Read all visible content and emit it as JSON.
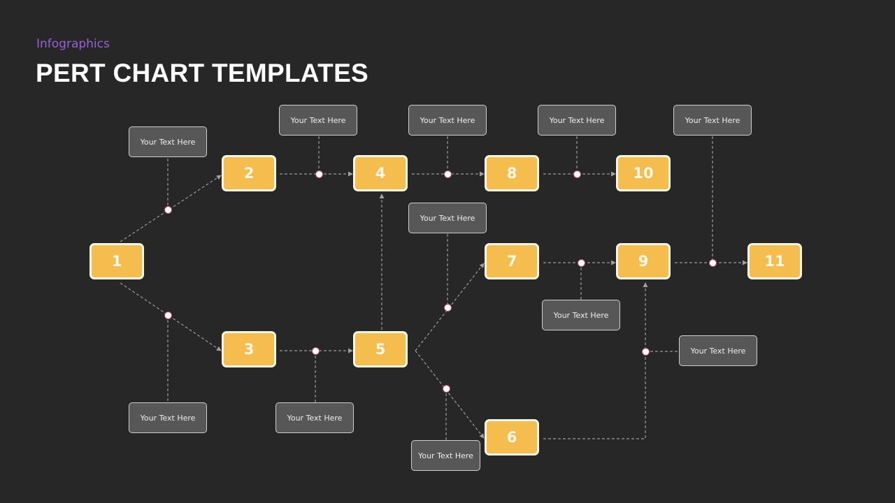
{
  "header": {
    "subtitle": "Infographics",
    "title": "PERT CHART TEMPLATES"
  },
  "colors": {
    "background": "#272727",
    "node_fill": "#f5bc4e",
    "node_border": "#fff7e6",
    "label_fill": "#575757",
    "accent_subtitle": "#9b5fd6",
    "dot_border": "#d04a6a",
    "connector": "#9a9a9a"
  },
  "nodes": [
    {
      "id": "1",
      "label": "1"
    },
    {
      "id": "2",
      "label": "2"
    },
    {
      "id": "3",
      "label": "3"
    },
    {
      "id": "4",
      "label": "4"
    },
    {
      "id": "5",
      "label": "5"
    },
    {
      "id": "6",
      "label": "6"
    },
    {
      "id": "7",
      "label": "7"
    },
    {
      "id": "8",
      "label": "8"
    },
    {
      "id": "9",
      "label": "9"
    },
    {
      "id": "10",
      "label": "10"
    },
    {
      "id": "11",
      "label": "11"
    }
  ],
  "edges": [
    {
      "from": "1",
      "to": "2",
      "note": "Your Text Here"
    },
    {
      "from": "1",
      "to": "3",
      "note": "Your Text Here"
    },
    {
      "from": "2",
      "to": "4",
      "note": "Your Text Here"
    },
    {
      "from": "3",
      "to": "5",
      "note": "Your Text Here"
    },
    {
      "from": "5",
      "to": "4",
      "note": ""
    },
    {
      "from": "4",
      "to": "8",
      "note": "Your Text Here"
    },
    {
      "from": "8",
      "to": "10",
      "note": "Your Text Here"
    },
    {
      "from": "5",
      "to": "7",
      "note": "Your Text Here"
    },
    {
      "from": "5",
      "to": "6",
      "note": "Your Text Here"
    },
    {
      "from": "7",
      "to": "9",
      "note": "Your Text Here"
    },
    {
      "from": "6",
      "to": "9",
      "note": "Your Text Here"
    },
    {
      "from": "9",
      "to": "11",
      "note": "Your Text Here"
    }
  ],
  "notes": [
    "Your Text Here",
    "Your Text Here",
    "Your Text Here",
    "Your Text Here",
    "Your Text Here",
    "Your Text Here",
    "Your Text Here",
    "Your Text Here",
    "Your Text Here",
    "Your Text Here",
    "Your Text Here"
  ]
}
